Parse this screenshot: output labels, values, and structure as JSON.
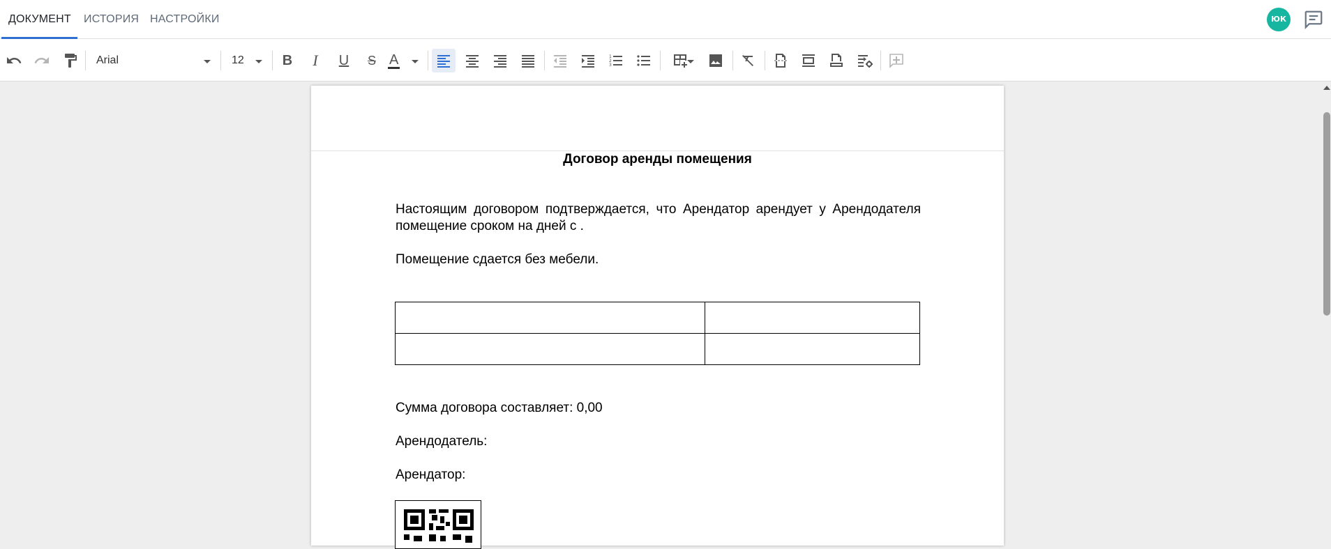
{
  "tabs": [
    {
      "label": "ДОКУМЕНТ",
      "active": true
    },
    {
      "label": "ИСТОРИЯ",
      "active": false
    },
    {
      "label": "НАСТРОЙКИ",
      "active": false
    }
  ],
  "user": {
    "initials": "ЮК",
    "avatar_color": "#17b6a0"
  },
  "toolbar": {
    "font_family": "Arial",
    "font_size": "12",
    "bold_label": "B",
    "italic_label": "I",
    "underline_label": "U",
    "strike_label": "S",
    "text_color_label": "A",
    "active_alignment": "left"
  },
  "document": {
    "title": "Договор аренды помещения",
    "paragraph1": "Настоящим договором подтверждается, что Арендатор арендует у Арендодателя  помещение сроком на  дней с .",
    "paragraph2": "Помещение сдается без мебели.",
    "table": [
      [
        "",
        ""
      ],
      [
        "",
        ""
      ]
    ],
    "sum_line": "Сумма договора составляет: 0,00",
    "landlord_line": "Арендодатель:",
    "tenant_line": "Арендатор:"
  },
  "colors": {
    "accent": "#2f6fd1",
    "avatar": "#17b6a0"
  }
}
